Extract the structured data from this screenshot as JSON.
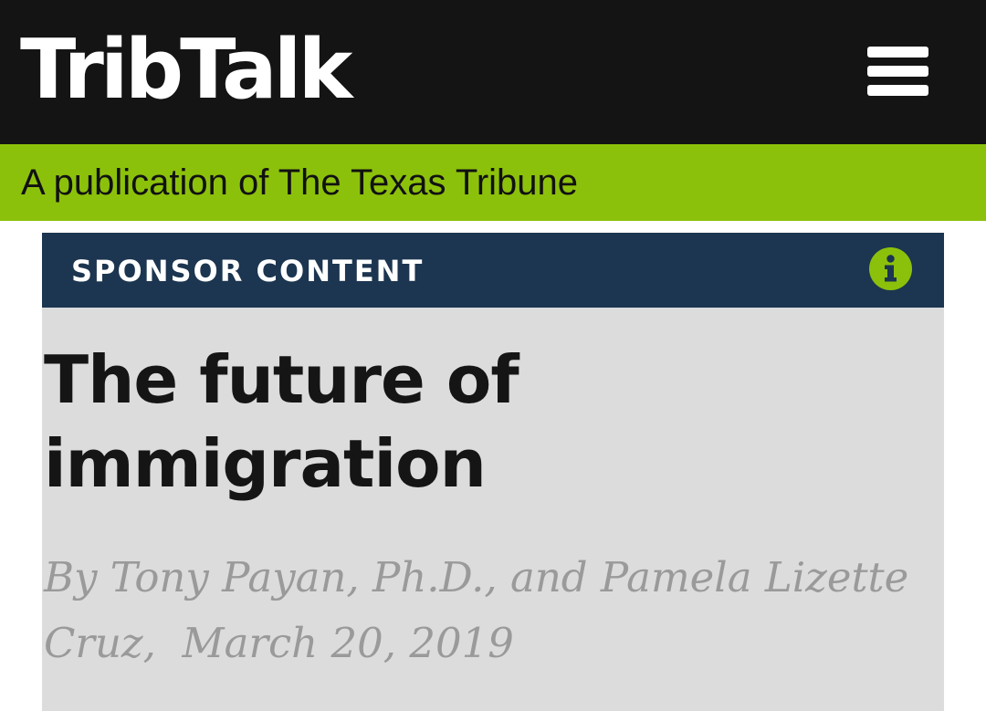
{
  "header": {
    "logo_text": "TribTalk",
    "menu_icon": "hamburger-menu-icon",
    "background_color": "#141414"
  },
  "tagline": {
    "text": "A publication of The Texas Tribune",
    "background_color": "#8cc10b"
  },
  "article": {
    "sponsor_label": "SPONSOR CONTENT",
    "info_icon": "info-icon",
    "sponsor_bar_color": "#1c3550",
    "title": "The future of immigration",
    "byline_author": "By Tony Payan, Ph.D., and Pamela Lizette Cruz,",
    "byline_date": "March 20, 2019",
    "card_color": "#dcdcdc"
  }
}
